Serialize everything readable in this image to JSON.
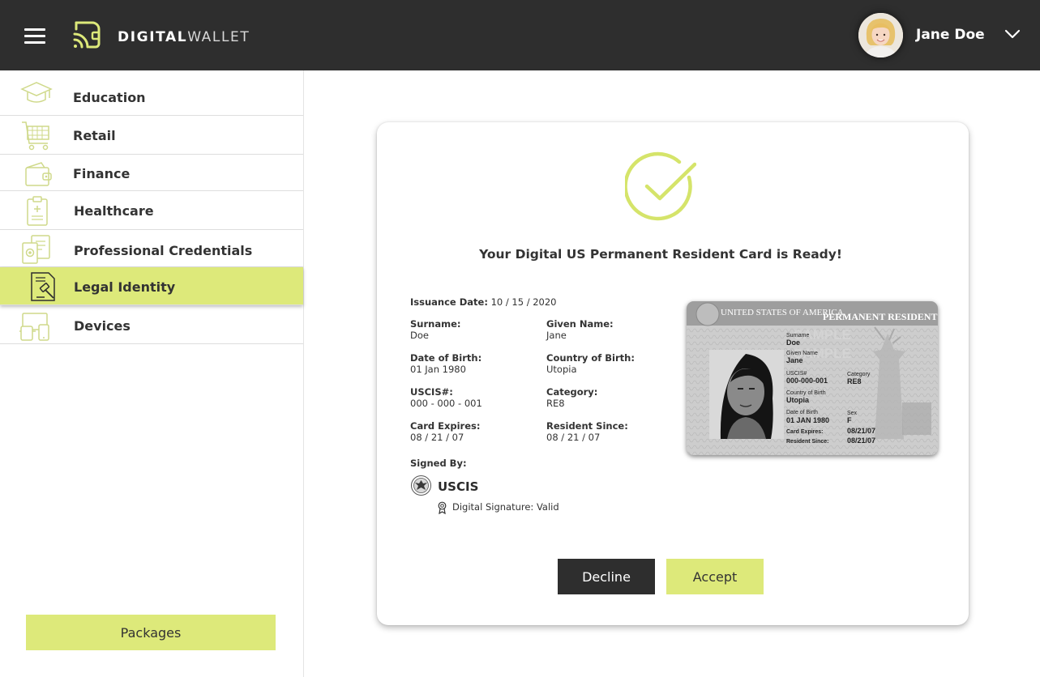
{
  "app": {
    "logo_bold": "DIGITAL",
    "logo_light": "WALLET"
  },
  "user": {
    "name": "Jane Doe"
  },
  "colors": {
    "accent": "#dde97a",
    "header_bg": "#2e2e2e",
    "check_color": "#d5e46a"
  },
  "sidebar": {
    "items": [
      {
        "label": "Education",
        "icon": "graduation-cap-icon"
      },
      {
        "label": "Retail",
        "icon": "shopping-cart-icon"
      },
      {
        "label": "Finance",
        "icon": "wallet-icon"
      },
      {
        "label": "Healthcare",
        "icon": "medical-clipboard-icon"
      },
      {
        "label": "Professional Credentials",
        "icon": "credentials-icon"
      },
      {
        "label": "Legal Identity",
        "icon": "gavel-document-icon",
        "active": true
      },
      {
        "label": "Devices",
        "icon": "devices-icon"
      }
    ],
    "packages_label": "Packages"
  },
  "card": {
    "title": "Your Digital US Permanent Resident Card is Ready!",
    "issuance_label": "Issuance Date:",
    "issuance_value": "10 / 15 / 2020",
    "fields": {
      "surname": {
        "label": "Surname:",
        "value": "Doe"
      },
      "given_name": {
        "label": "Given Name:",
        "value": "Jane"
      },
      "dob": {
        "label": "Date of Birth:",
        "value": "01 Jan 1980"
      },
      "country": {
        "label": "Country of Birth:",
        "value": "Utopia"
      },
      "uscis": {
        "label": "USCIS#:",
        "value": "000 - 000 - 001"
      },
      "category": {
        "label": "Category:",
        "value": "RE8"
      },
      "expires": {
        "label": "Card Expires:",
        "value": "08 / 21 / 07"
      },
      "resident_since": {
        "label": "Resident Since:",
        "value": "08 / 21 / 07"
      }
    },
    "signed_by_label": "Signed By:",
    "issuer": "USCIS",
    "signature_status": "Digital Signature: Valid",
    "decline_label": "Decline",
    "accept_label": "Accept"
  },
  "id_card": {
    "header_left": "UNITED STATES OF AMERICA",
    "header_right": "PERMANENT RESIDENT",
    "watermark": "SAMPLE",
    "surname_label": "Surname",
    "surname": "Doe",
    "given_label": "Given Name",
    "given": "Jane",
    "uscis_label": "USCIS#",
    "uscis": "000-000-001",
    "category_label": "Category",
    "category": "RE8",
    "country_label": "Country of Birth",
    "country": "Utopia",
    "dob_label": "Date of Birth",
    "dob": "01 JAN 1980",
    "sex_label": "Sex",
    "sex": "F",
    "expires_label": "Card Expires:",
    "expires": "08/21/07",
    "resident_label": "Resident Since:",
    "resident": "08/21/07"
  }
}
